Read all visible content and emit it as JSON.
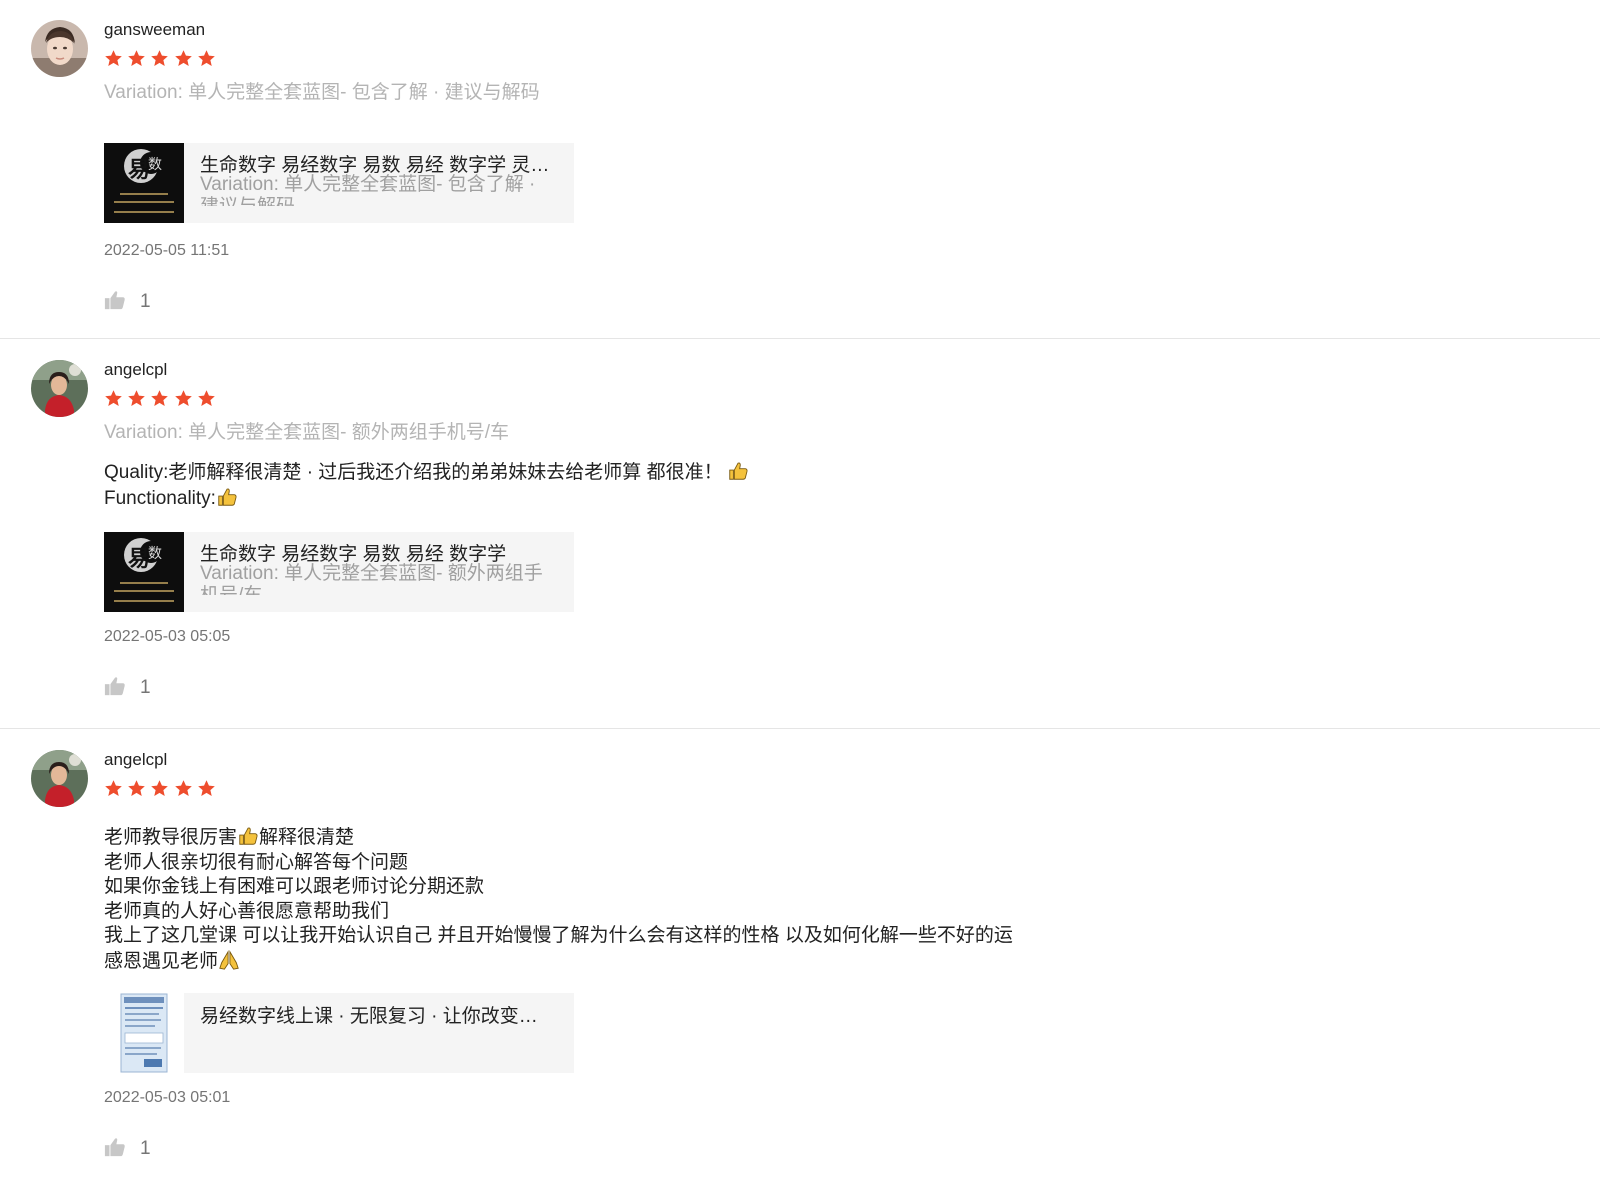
{
  "colors": {
    "star": "#ee4d2d",
    "divider": "#e5e5e5",
    "muted": "#757575",
    "variation": "#b4b4b4",
    "card_bg": "#f5f5f5"
  },
  "reviews": [
    {
      "username": "gansweeman",
      "rating": 5,
      "variation": "Variation: 单人完整全套蓝图- 包含了解 · 建议与解码",
      "comment_lines": [],
      "product": {
        "title": "生命数字 易经数字 易数 易经 数字学 灵数 生命数字",
        "variation": "Variation: 单人完整全套蓝图- 包含了解 · 建议与解码",
        "thumb_icon": "yijing-logo-thumbnail"
      },
      "timestamp": "2022-05-05 11:51",
      "likes": "1"
    },
    {
      "username": "angelcpl",
      "rating": 5,
      "variation": "Variation: 单人完整全套蓝图- 额外两组手机号/车",
      "comment_lines": [
        "Quality:老师解释很清楚 · 过后我还介绍我的弟弟妹妹去给老师算 都很准！",
        "Functionality:"
      ],
      "product": {
        "title": "生命数字 易经数字 易数 易经 数字学",
        "variation": "Variation: 单人完整全套蓝图- 额外两组手机号/车",
        "thumb_icon": "yijing-logo-thumbnail"
      },
      "timestamp": "2022-05-03 05:05",
      "likes": "1"
    },
    {
      "username": "angelcpl",
      "rating": 5,
      "variation": "",
      "comment_lines": [
        "老师教导很厉害",
        "解释很清楚",
        "老师人很亲切很有耐心解答每个问题",
        "如果你金钱上有困难可以跟老师讨论分期还款",
        "老师真的人好心善很愿意帮助我们",
        "我上了这几堂课 可以让我开始认识自己 并且开始慢慢了解为什么会有这样的性格 以及如何化解一些不好的运",
        "感恩遇见老师"
      ],
      "product": {
        "title": "易经数字线上课 · 无限复习 · 让你改变人生",
        "variation": "",
        "thumb_icon": "course-flyer-thumbnail"
      },
      "timestamp": "2022-05-03 05:01",
      "likes": "1"
    }
  ]
}
